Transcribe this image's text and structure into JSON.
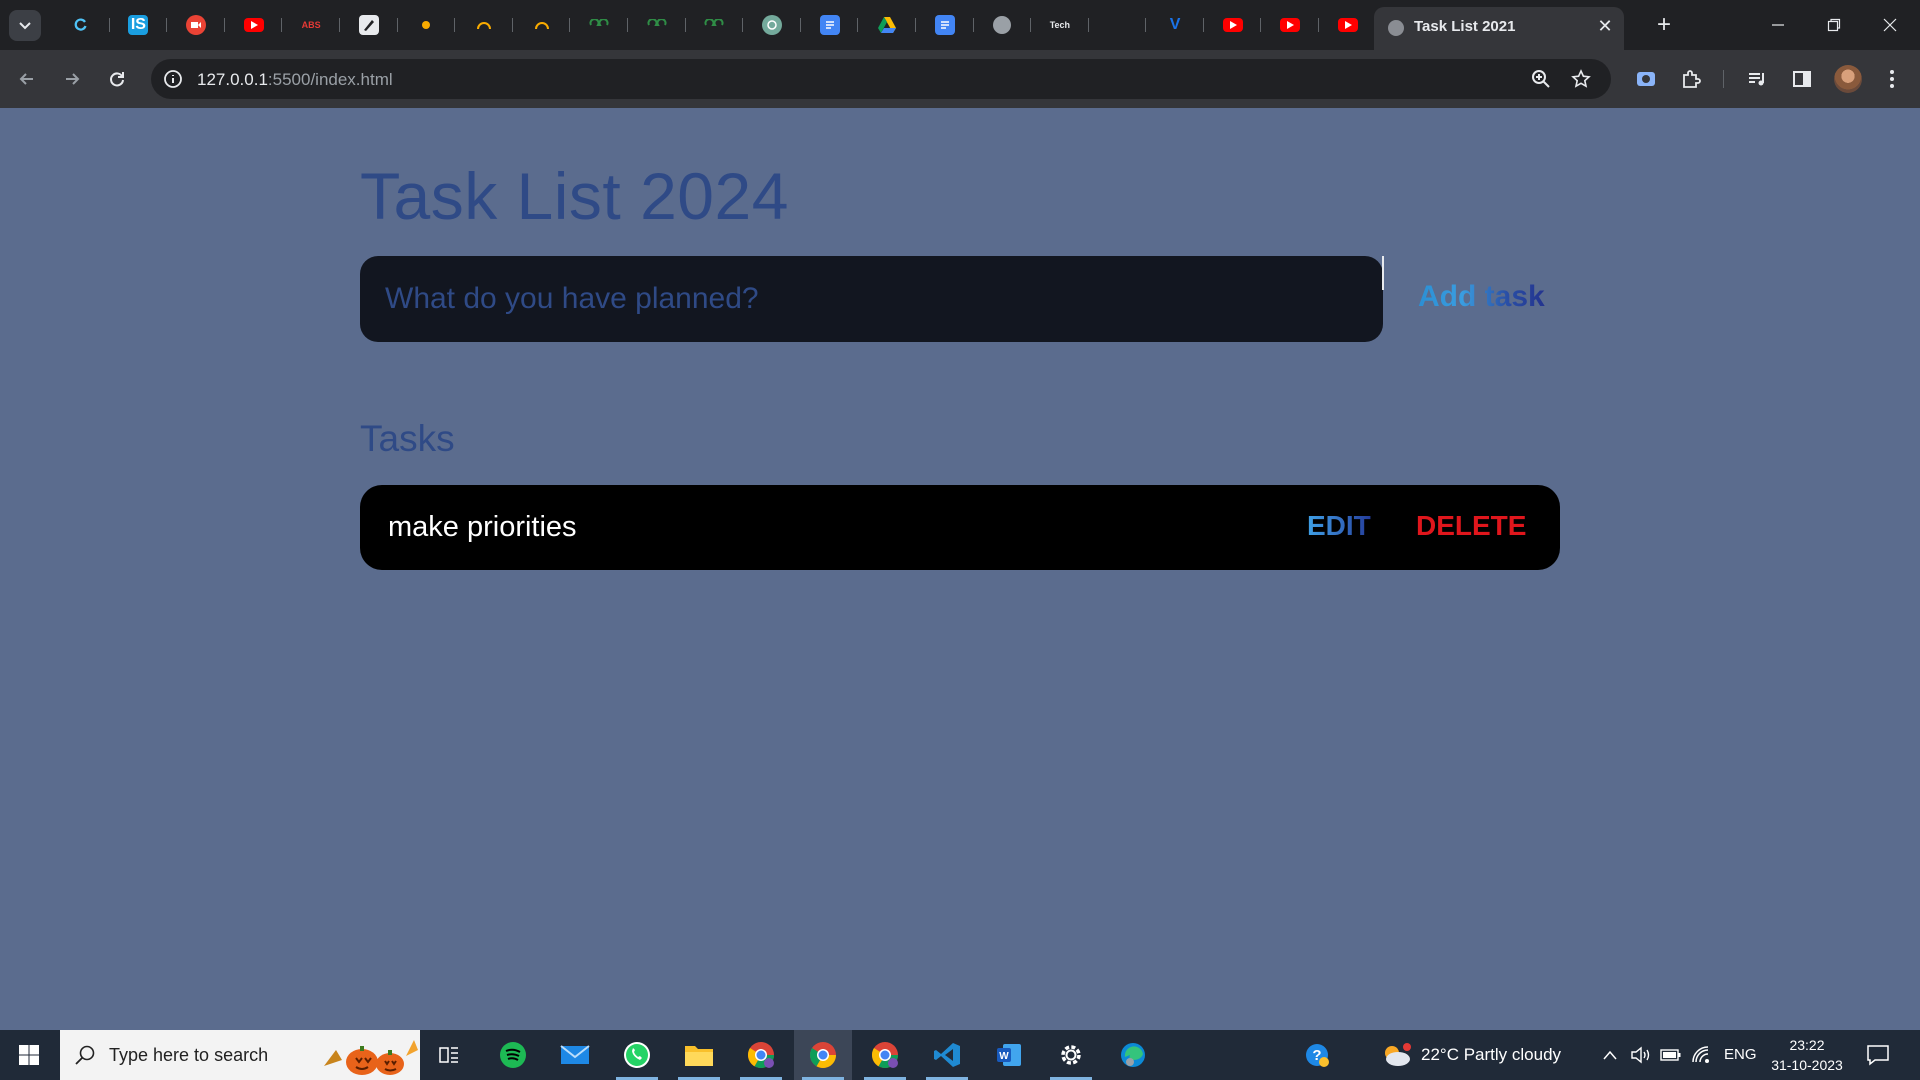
{
  "browser": {
    "active_tab_title": "Task List 2021",
    "url_host": "127.0.0.1",
    "url_rest": ":5500/index.html",
    "pinned_tabs": [
      {
        "icon": "refresh-app-icon",
        "color": "#1a73e8",
        "label": ""
      },
      {
        "icon": "is-app-icon",
        "color": "#1a9ee0",
        "label": "IS"
      },
      {
        "icon": "video-app-icon",
        "color": "#ea4335",
        "label": ""
      },
      {
        "icon": "youtube-icon",
        "color": "#ff0000",
        "label": ""
      },
      {
        "icon": "abs-app-icon",
        "color": "#e53935",
        "label": "ABS"
      },
      {
        "icon": "pen-app-icon",
        "color": "#e8eaed",
        "label": ""
      },
      {
        "icon": "dot-app-icon",
        "color": "#f9ab00",
        "label": ""
      },
      {
        "icon": "arc-app-icon",
        "color": "#f9ab00",
        "label": ""
      },
      {
        "icon": "arc-app-icon",
        "color": "#f9ab00",
        "label": ""
      },
      {
        "icon": "gfg-icon",
        "color": "#2f8d46",
        "label": ""
      },
      {
        "icon": "gfg-icon",
        "color": "#2f8d46",
        "label": ""
      },
      {
        "icon": "gfg-icon",
        "color": "#2f8d46",
        "label": ""
      },
      {
        "icon": "chatgpt-icon",
        "color": "#74aa9c",
        "label": ""
      },
      {
        "icon": "docs-icon",
        "color": "#4285f4",
        "label": ""
      },
      {
        "icon": "drive-icon",
        "color": "#0f9d58",
        "label": ""
      },
      {
        "icon": "docs-icon",
        "color": "#4285f4",
        "label": ""
      },
      {
        "icon": "globe-icon",
        "color": "#9aa0a6",
        "label": ""
      },
      {
        "icon": "tech-app-icon",
        "color": "#e8eaed",
        "label": "Tech"
      },
      {
        "icon": "blank-icon",
        "color": "#202124",
        "label": ""
      },
      {
        "icon": "v-app-icon",
        "color": "#1a73e8",
        "label": "V"
      },
      {
        "icon": "youtube-icon",
        "color": "#ff0000",
        "label": ""
      },
      {
        "icon": "youtube-icon",
        "color": "#ff0000",
        "label": ""
      },
      {
        "icon": "youtube-icon",
        "color": "#ff0000",
        "label": ""
      }
    ]
  },
  "page": {
    "title": "Task List 2024",
    "input_placeholder": "What do you have planned?",
    "add_button": "Add task",
    "section_title": "Tasks",
    "tasks": [
      {
        "text": "make priorities",
        "edit_label": "EDIT",
        "delete_label": "DELETE"
      }
    ]
  },
  "taskbar": {
    "search_placeholder": "Type here to search",
    "weather": "22°C  Partly cloudy",
    "language": "ENG",
    "time": "23:22",
    "date": "31-10-2023",
    "apps": [
      {
        "icon": "task-view-icon"
      },
      {
        "icon": "spotify-icon"
      },
      {
        "icon": "mail-icon"
      },
      {
        "icon": "whatsapp-icon"
      },
      {
        "icon": "file-explorer-icon"
      },
      {
        "icon": "chrome-profile-icon"
      },
      {
        "icon": "chrome-icon"
      },
      {
        "icon": "chrome-profile-icon"
      },
      {
        "icon": "vscode-icon"
      },
      {
        "icon": "word-icon"
      },
      {
        "icon": "settings-icon"
      },
      {
        "icon": "edge-icon"
      }
    ]
  },
  "colors": {
    "page_bg": "#5b6c8e",
    "title": "#2f4a86",
    "input_bg": "#121620",
    "task_bg": "#000000",
    "delete": "#e0161c"
  }
}
